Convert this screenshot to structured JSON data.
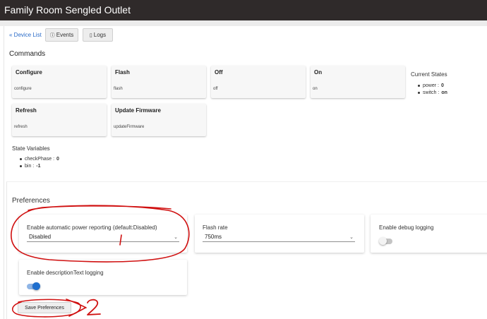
{
  "window": {
    "title": "Family Room Sengled Outlet"
  },
  "nav": {
    "device_list_link": "« Device List",
    "events_button": "Events",
    "logs_button": "Logs"
  },
  "commands": {
    "title": "Commands",
    "items": [
      {
        "name": "Configure",
        "arg": "configure"
      },
      {
        "name": "Flash",
        "arg": "flash"
      },
      {
        "name": "Off",
        "arg": "off"
      },
      {
        "name": "On",
        "arg": "on"
      },
      {
        "name": "Refresh",
        "arg": "refresh"
      },
      {
        "name": "Update Firmware",
        "arg": "updateFirmware"
      }
    ]
  },
  "current_states": {
    "title": "Current States",
    "items": [
      {
        "key": "power :",
        "value": "0"
      },
      {
        "key": "switch :",
        "value": "on"
      }
    ]
  },
  "state_variables": {
    "title": "State Variables",
    "items": [
      {
        "key": "checkPhase :",
        "value": "0"
      },
      {
        "key": "bin :",
        "value": "-1"
      }
    ]
  },
  "preferences": {
    "title": "Preferences",
    "power_reporting": {
      "label": "Enable automatic power reporting (default:Disabled)",
      "value": "Disabled"
    },
    "flash_rate": {
      "label": "Flash rate",
      "value": "750ms"
    },
    "debug_logging": {
      "label": "Enable debug logging",
      "enabled": false
    },
    "description_logging": {
      "label": "Enable descriptionText logging",
      "enabled": true
    },
    "save_label": "Save Preferences"
  },
  "annotations": {
    "mark_1": "1",
    "mark_2": "2",
    "color": "#d01010"
  },
  "colors": {
    "titlebar": "#2f2a2a",
    "link": "#2a6bc8",
    "toggle_on": "#1f6fce"
  }
}
